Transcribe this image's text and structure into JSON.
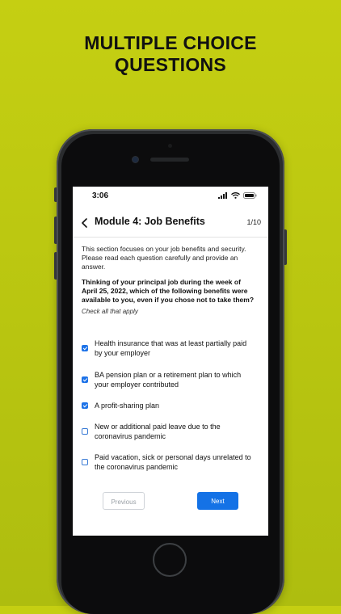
{
  "promo": {
    "headline_line1": "MULTIPLE CHOICE",
    "headline_line2": "QUESTIONS"
  },
  "status_bar": {
    "time": "3:06"
  },
  "header": {
    "title": "Module 4: Job Benefits",
    "counter": "1/10"
  },
  "content": {
    "intro": "This section focuses on your job benefits and security. Please read each question carefully and provide an answer.",
    "question": "Thinking of your principal job during the week of April 25, 2022, which of the following benefits were available to you, even if you chose not to take them?",
    "hint": "Check all that apply"
  },
  "options": [
    {
      "label": "Health insurance that was at least partially paid by your employer",
      "checked": true
    },
    {
      "label": "BA pension plan or a retirement plan to which your employer contributed",
      "checked": true
    },
    {
      "label": "A profit-sharing plan",
      "checked": true
    },
    {
      "label": "New or additional paid leave due to the coronavirus pandemic",
      "checked": false
    },
    {
      "label": "Paid vacation, sick or personal days unrelated to the coronavirus pandemic",
      "checked": false
    }
  ],
  "buttons": {
    "previous": "Previous",
    "next": "Next"
  },
  "colors": {
    "background": "#bcc711",
    "accent": "#1472e6"
  },
  "icons": [
    "back-chevron-icon",
    "signal-icon",
    "wifi-icon",
    "battery-icon",
    "checkbox-checked-icon",
    "checkbox-unchecked-icon"
  ]
}
